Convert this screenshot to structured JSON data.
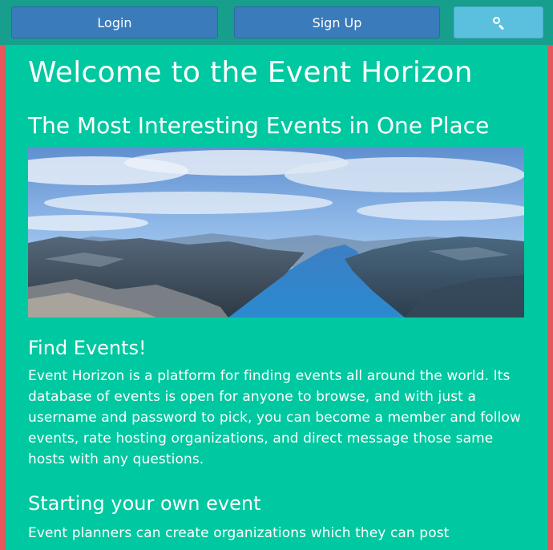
{
  "nav": {
    "login_label": "Login",
    "signup_label": "Sign Up",
    "search_icon": "search-icon"
  },
  "main": {
    "title": "Welcome to the Event Horizon",
    "subtitle": "The Most Interesting Events in One Place",
    "hero_image": "fjord-landscape",
    "sections": [
      {
        "title": "Find Events!",
        "body": "Event Horizon is a platform for finding events all around the world. Its database of events is open for anyone to browse, and with just a username and password to pick, you can become a member and follow events, rate hosting organizations, and direct message those same hosts with any questions."
      },
      {
        "title": "Starting your own event",
        "body": "Event planners can create organizations which they can post"
      }
    ]
  },
  "colors": {
    "navbar": "#179e8c",
    "content_bg": "#00c8a0",
    "border": "#e8555a",
    "primary_button": "#3a7bbb",
    "search_button": "#5bc0de"
  }
}
